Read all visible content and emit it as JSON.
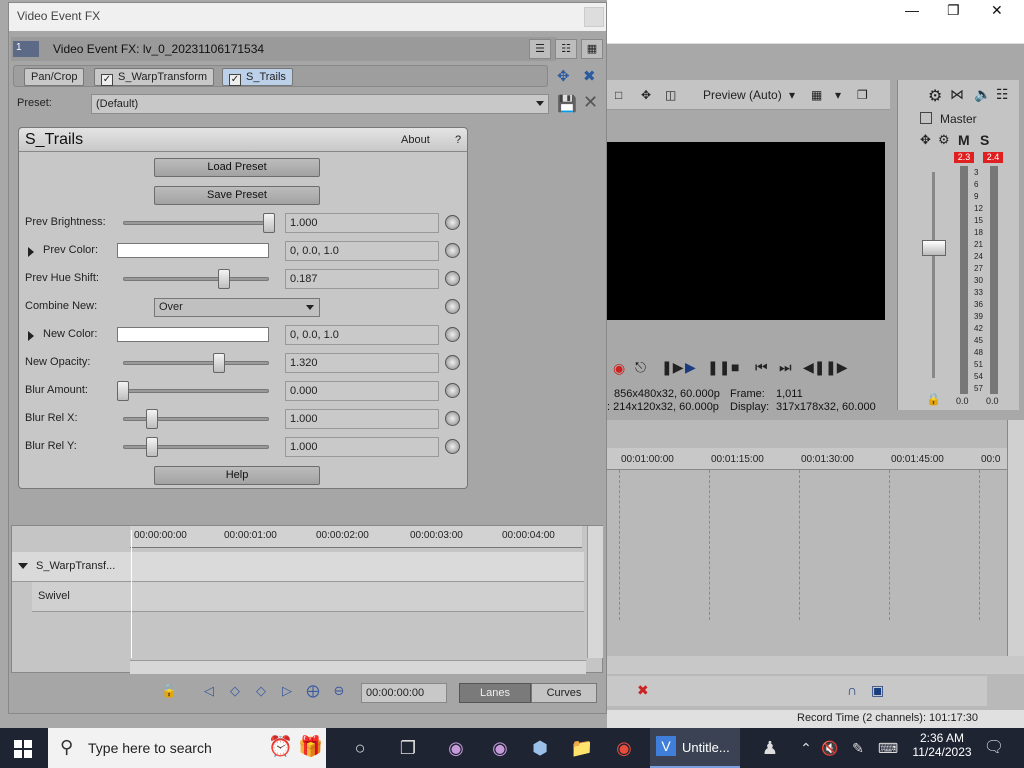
{
  "fx_window": {
    "title": "Video Event FX",
    "tag": "1",
    "header_title": "Video Event FX:  lv_0_20231106171534",
    "chain": [
      "Pan/Crop",
      "S_WarpTransform",
      "S_Trails"
    ],
    "preset_label": "Preset:",
    "preset_value": "(Default)"
  },
  "plugin": {
    "name": "S_Trails",
    "about": "About",
    "help_q": "?",
    "load_preset": "Load Preset",
    "save_preset": "Save Preset",
    "help": "Help",
    "params": [
      {
        "label": "Prev Brightness:",
        "value": "1.000",
        "pos": 1.0
      },
      {
        "label": "Prev Color:",
        "value": "0, 0.0, 1.0"
      },
      {
        "label": "Prev Hue Shift:",
        "value": "0.187",
        "pos": 0.69
      },
      {
        "label": "Combine New:",
        "value": "Over"
      },
      {
        "label": "New Color:",
        "value": "0, 0.0, 1.0"
      },
      {
        "label": "New Opacity:",
        "value": "1.320",
        "pos": 0.66
      },
      {
        "label": "Blur Amount:",
        "value": "0.000",
        "pos": 0.0
      },
      {
        "label": "Blur Rel X:",
        "value": "1.000",
        "pos": 0.2
      },
      {
        "label": "Blur Rel Y:",
        "value": "1.000",
        "pos": 0.2
      }
    ]
  },
  "keyframes": {
    "ruler": [
      "00:00:00:00",
      "00:00:01:00",
      "00:00:02:00",
      "00:00:03:00",
      "00:00:04:00"
    ],
    "track1": "S_WarpTransf...",
    "track2": "Swivel",
    "time": "00:00:00:00",
    "lanes": "Lanes",
    "curves": "Curves"
  },
  "background": {
    "preview_label": "Preview (Auto)",
    "master": "Master",
    "m": "M",
    "s": "S",
    "peak_l": "2.3",
    "peak_r": "2.4",
    "meter_ticks": [
      "3",
      "6",
      "9",
      "12",
      "15",
      "18",
      "21",
      "24",
      "27",
      "30",
      "33",
      "36",
      "39",
      "42",
      "45",
      "48",
      "51",
      "54",
      "57"
    ],
    "meter_bottom_l": "0.0",
    "meter_bottom_r": "0.0",
    "project": "856x480x32, 60.000p",
    "frame": "Frame:",
    "frame_val": "1,011",
    "preview_res": ": 214x120x32, 60.000p",
    "display": "Display:",
    "display_val": "317x178x32, 60.000",
    "timeline_ticks": [
      "00:01:00:00",
      "00:01:15:00",
      "00:01:30:00",
      "00:01:45:00",
      "00:0"
    ],
    "record_time": "Record Time (2 channels): 101:17:30"
  },
  "taskbar": {
    "search_placeholder": "Type here to search",
    "active_app": "Untitle...",
    "time": "2:36 AM",
    "date": "11/24/2023"
  },
  "colors": {
    "accent": "#bcd0ea",
    "taskbar": "#1f2433",
    "meter_peak": "#e02020"
  }
}
